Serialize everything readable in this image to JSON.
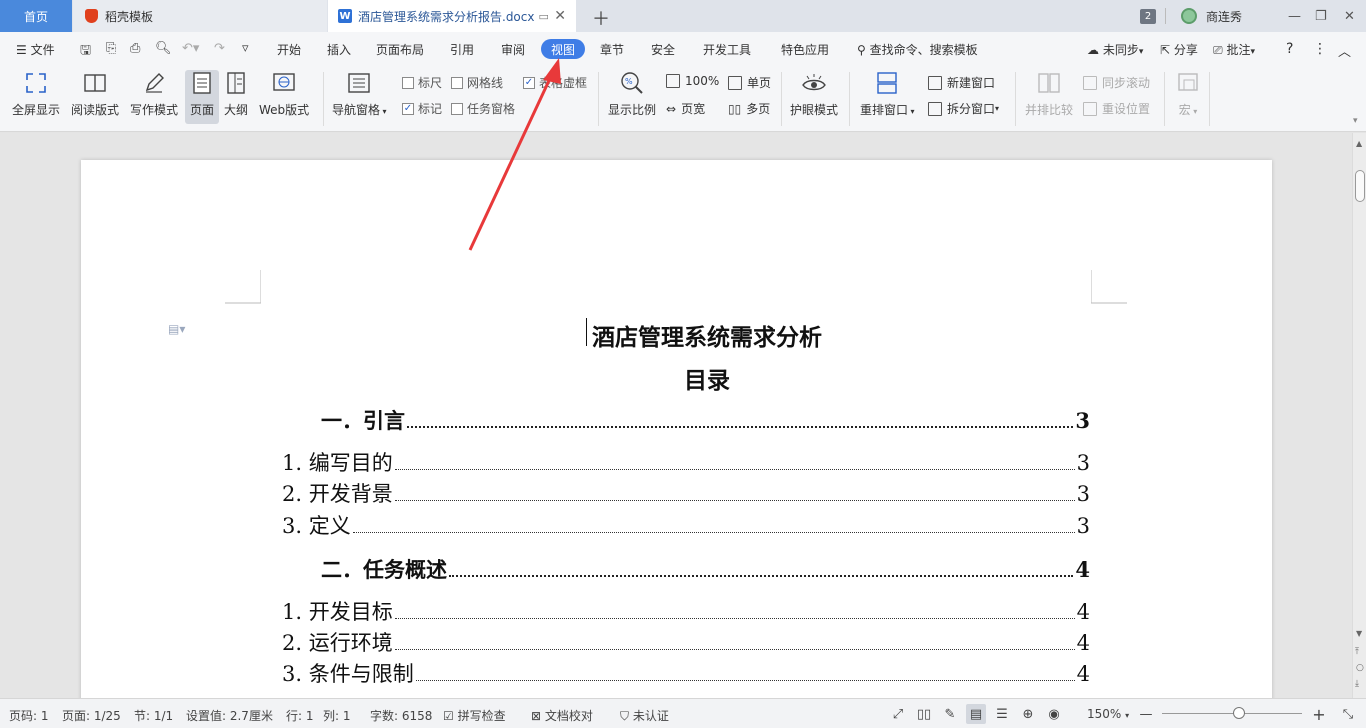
{
  "tabs": {
    "home": "首页",
    "daoke": "稻壳模板",
    "doc": "酒店管理系统需求分析报告.docx",
    "doc_icon": "W",
    "badge": "2",
    "user": "商连秀"
  },
  "menu": {
    "file": "文件",
    "items": [
      "开始",
      "插入",
      "页面布局",
      "引用",
      "审阅",
      "视图",
      "章节",
      "安全",
      "开发工具",
      "特色应用"
    ],
    "search": "查找命令、搜索模板",
    "sync": "未同步",
    "share": "分享",
    "comment": "批注"
  },
  "ribbon": {
    "fullscreen": "全屏显示",
    "read": "阅读版式",
    "write": "写作模式",
    "page": "页面",
    "outline": "大纲",
    "web": "Web版式",
    "nav": "导航窗格",
    "ruler": "标尺",
    "grid": "网格线",
    "table_border": "表格虚框",
    "mark": "标记",
    "task_pane": "任务窗格",
    "zoom": "显示比例",
    "zoom100": "100%",
    "single": "单页",
    "pagewidth": "页宽",
    "multi": "多页",
    "eye": "护眼模式",
    "rearrange": "重排窗口",
    "newwin": "新建窗口",
    "split": "拆分窗口",
    "compare": "并排比较",
    "syncscroll": "同步滚动",
    "resetpos": "重设位置",
    "macro": "宏"
  },
  "document": {
    "title": "酒店管理系统需求分析",
    "toc_title": "目录",
    "toc": [
      {
        "level": "h",
        "label": "一．引言",
        "page": "3"
      },
      {
        "level": "s",
        "label": "1. 编写目的",
        "page": "3"
      },
      {
        "level": "s",
        "label": "2. 开发背景",
        "page": "3"
      },
      {
        "level": "s",
        "label": "3. 定义",
        "page": "3"
      },
      {
        "level": "h",
        "label": "二．任务概述",
        "page": "4"
      },
      {
        "level": "s",
        "label": "1. 开发目标",
        "page": "4"
      },
      {
        "level": "s",
        "label": "2. 运行环境",
        "page": "4"
      },
      {
        "level": "s",
        "label": "3. 条件与限制",
        "page": "4"
      }
    ]
  },
  "status": {
    "pagenum": "页码: 1",
    "pages": "页面: 1/25",
    "section": "节: 1/1",
    "setting": "设置值: 2.7厘米",
    "row": "行: 1",
    "col": "列: 1",
    "words": "字数: 6158",
    "spell": "拼写检查",
    "proof": "文档校对",
    "auth": "未认证",
    "zoom": "150%"
  },
  "colors": {
    "accent": "#3f7de6",
    "home_tab": "#4a89dc",
    "arrow": "#e8393a"
  }
}
